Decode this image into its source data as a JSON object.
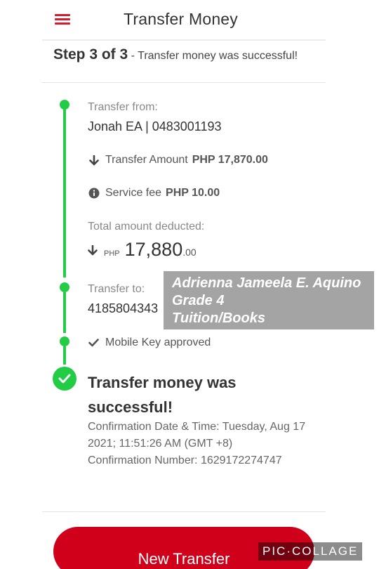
{
  "header": {
    "title": "Transfer Money",
    "menu_icon": "hamburger-menu-icon"
  },
  "step": {
    "label": "Step 3 of 3",
    "text": "- Transfer money was successful!"
  },
  "transfer_from": {
    "label": "Transfer from:",
    "value": "Jonah EA | 0483001193"
  },
  "transfer_amount": {
    "icon": "arrow-down-icon",
    "label": "Transfer Amount",
    "value": "PHP 17,870.00"
  },
  "service_fee": {
    "icon": "info-icon",
    "label": "Service fee",
    "value": "PHP 10.00"
  },
  "total": {
    "label": "Total amount deducted:",
    "icon": "arrow-down-icon",
    "currency": "PHP",
    "whole": "17,880",
    "cents": ".00"
  },
  "transfer_to": {
    "label": "Transfer to:",
    "value": "4185804343"
  },
  "overlay_note": {
    "line1": "Adrienna Jameela E. Aquino",
    "line2": "Grade 4",
    "line3": "Tuition/Books"
  },
  "mobile_key": {
    "icon": "check-icon",
    "label": "Mobile Key approved"
  },
  "success": {
    "title": "Transfer money was successful!",
    "confirmation_datetime": "Confirmation Date & Time: Tuesday, Aug 17 2021; 11:51:26 AM (GMT +8)",
    "confirmation_number": "Confirmation Number: 1629172274747"
  },
  "new_transfer_button": "New Transfer",
  "watermark": "PIC·COLLAGE",
  "colors": {
    "accent": "#d0001b",
    "timeline": "#22cc44",
    "overlay": "#a4a4a4"
  }
}
